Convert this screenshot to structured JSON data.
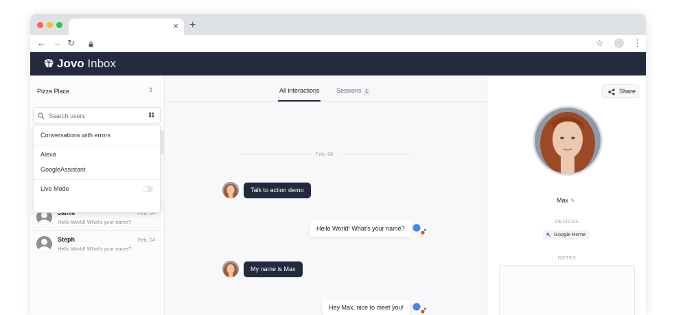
{
  "browser": {
    "new_tab_symbol": "+",
    "close_tab_symbol": "×",
    "nav": {
      "back": "←",
      "forward": "→",
      "reload": "↻",
      "lock": "lock-icon",
      "bookmark": "☆",
      "menu": "⋮"
    }
  },
  "app": {
    "logo_bold": "Jovo",
    "logo_light": "Inbox"
  },
  "sidebar": {
    "project": "Pizza Place",
    "search_placeholder": "Search users",
    "dropdown": {
      "errors": "Conversations with errors",
      "platforms": [
        "Alexa",
        "GoogleAssistant"
      ],
      "live_mode": "Live Mode",
      "live_mode_on": false
    },
    "users": [
      {
        "name": "Jamie",
        "message": "Hello World! What's your name?",
        "date": "Feb, 04"
      },
      {
        "name": "Steph",
        "message": "Hello World! What's your name?",
        "date": "Feb, 04"
      }
    ]
  },
  "center": {
    "tabs": [
      {
        "label": "All interactions",
        "active": true
      },
      {
        "label": "Sessions",
        "badge": "1",
        "active": false
      }
    ],
    "date_divider": "Feb, 08",
    "messages": [
      {
        "from": "user",
        "text": "Talk to action demo"
      },
      {
        "from": "assistant",
        "text": "Hello World! What's your name?"
      },
      {
        "from": "user",
        "text": "My name is Max"
      },
      {
        "from": "assistant",
        "text": "Hey Max, nice to meet you!"
      }
    ]
  },
  "profile": {
    "share_label": "Share",
    "name": "Max",
    "devices_heading": "DEVICES",
    "device": "Google Home",
    "notes_heading": "NOTES"
  },
  "colors": {
    "header_bg": "#232a3d",
    "bubble_dark": "#232a3d",
    "ga_blue": "#4285f4",
    "ga_red": "#ea4335",
    "ga_yellow": "#fbbc05",
    "ga_green": "#34a853"
  }
}
